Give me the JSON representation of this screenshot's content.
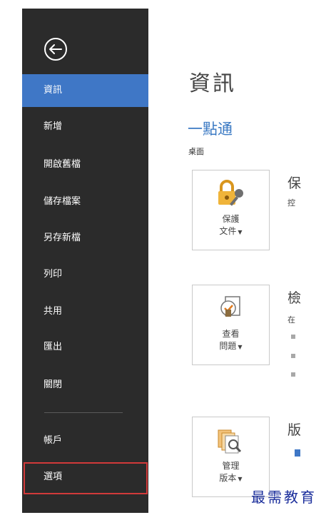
{
  "sidebar": {
    "items": [
      {
        "label": "資訊"
      },
      {
        "label": "新增"
      },
      {
        "label": "開啟舊檔"
      },
      {
        "label": "儲存檔案"
      },
      {
        "label": "另存新檔"
      },
      {
        "label": "列印"
      },
      {
        "label": "共用"
      },
      {
        "label": "匯出"
      },
      {
        "label": "關閉"
      },
      {
        "label": "帳戶"
      },
      {
        "label": "選項"
      }
    ],
    "back_icon": "back-arrow-icon"
  },
  "main": {
    "title": "資訊",
    "doc_name": "一點通",
    "doc_path": "桌面",
    "sections": [
      {
        "tile_line1": "保護",
        "tile_line2": "文件",
        "heading": "保",
        "desc": "控",
        "icon": "lock-key-icon"
      },
      {
        "tile_line1": "查看",
        "tile_line2": "問題",
        "heading": "檢",
        "desc": "在",
        "icon": "inspect-document-icon"
      },
      {
        "tile_line1": "管理",
        "tile_line2": "版本",
        "heading": "版",
        "desc": "",
        "icon": "manage-versions-icon"
      }
    ]
  },
  "watermark": "最需教育",
  "colors": {
    "sidebar_bg": "#2b2b2b",
    "active_item": "#3f77c6",
    "accent_text": "#3a79c3",
    "highlight_border": "#d23a3a"
  }
}
